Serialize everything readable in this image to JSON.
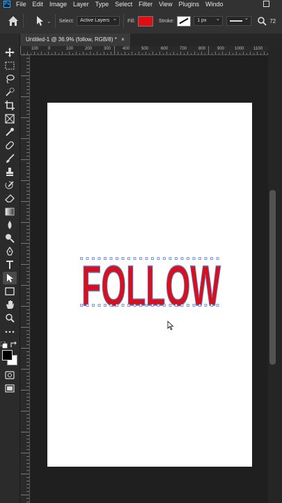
{
  "menu": {
    "app_badge": "Ps",
    "items": [
      "File",
      "Edit",
      "Image",
      "Layer",
      "Type",
      "Select",
      "Filter",
      "View",
      "Plugins",
      "Windo"
    ]
  },
  "options": {
    "select_label": "Select:",
    "select_value": "Active Layers",
    "fill_label": "Fill:",
    "fill_color": "#e00d12",
    "stroke_label": "Stroke:",
    "stroke_width": "1 px",
    "zoom_partial": "72"
  },
  "document": {
    "tab_title": "Untitled-1 @ 36.9% (follow, RGB/8) *",
    "close_glyph": "×"
  },
  "ruler": {
    "h_labels": [
      "100",
      "0",
      "100",
      "200",
      "300",
      "400",
      "500",
      "600",
      "700",
      "800",
      "900",
      "1000",
      "1100"
    ]
  },
  "canvas": {
    "text": "FOLLOW",
    "text_color": "#d8101c",
    "outline_color": "#5b7fd6",
    "background": "#ffffff"
  },
  "icons": {
    "home": "home-icon",
    "path_select": "path-selection-icon",
    "search": "search-icon"
  }
}
